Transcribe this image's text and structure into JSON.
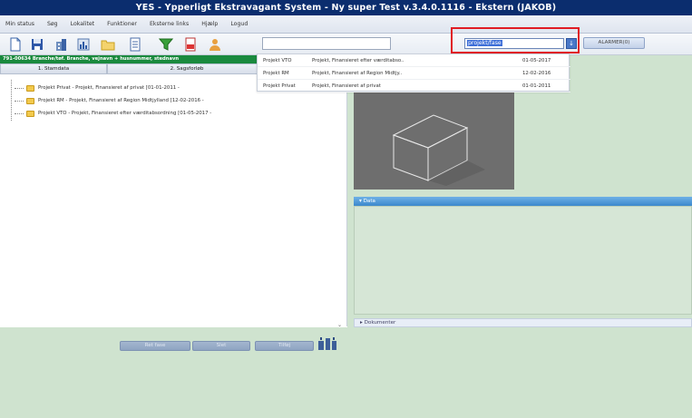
{
  "window": {
    "title": "YES - Ypperligt Ekstravagant System - Ny super Test v.3.4.0.1116 - Ekstern (JAKOB)"
  },
  "menu": {
    "items": [
      "Min status",
      "Søg",
      "Lokalitet",
      "Funktioner",
      "Eksterne links",
      "Hjælp",
      "Logud"
    ]
  },
  "toolbar": {
    "icons": [
      "new-document-icon",
      "save-icon",
      "building-icon",
      "chart-icon",
      "folder-icon",
      "report-icon",
      "filter-icon",
      "pdf-icon",
      "user-icon"
    ],
    "search_value": "",
    "combo_value": "projekt/fase",
    "combo_button": "↓",
    "alarm_button": "ALARMER(0)"
  },
  "left": {
    "header": "791-00634 Branche/tøf. Branche, vejnavn + husnummer, stednavn",
    "tabs": [
      "1. Stamdata",
      "2. Sagsforløb",
      ""
    ],
    "tree": [
      "Projekt Privat - Projekt, Finansieret af privat [01-01-2011 -",
      "Projekt RM - Projekt, Finansieret af Region Midtjylland [12-02-2016 -",
      "Projekt VTO - Projekt, Finansieret efter værditabsordning [01-05-2017 -"
    ],
    "buttons": [
      "Ret fase",
      "Slet",
      "Tilføj"
    ]
  },
  "dropdown": {
    "rows": [
      {
        "name": "Projekt VTO",
        "desc": "Projekt, Finansieret efter værditabso..",
        "date": "01-05-2017"
      },
      {
        "name": "Projekt RM",
        "desc": "Projekt, Finansieret af Region Midtjy..",
        "date": "12-02-2016"
      },
      {
        "name": "Projekt Privat",
        "desc": "Projekt, Finansieret af privat",
        "date": "01-01-2011"
      }
    ]
  },
  "right": {
    "data_header": "Data",
    "dokumenter_header": "Dokumenter"
  },
  "colors": {
    "title_bg": "#0b2d6e",
    "highlight": "#e01c24",
    "left_header_bg": "#1a8a3e",
    "panel_bg": "#cfe3cf"
  }
}
